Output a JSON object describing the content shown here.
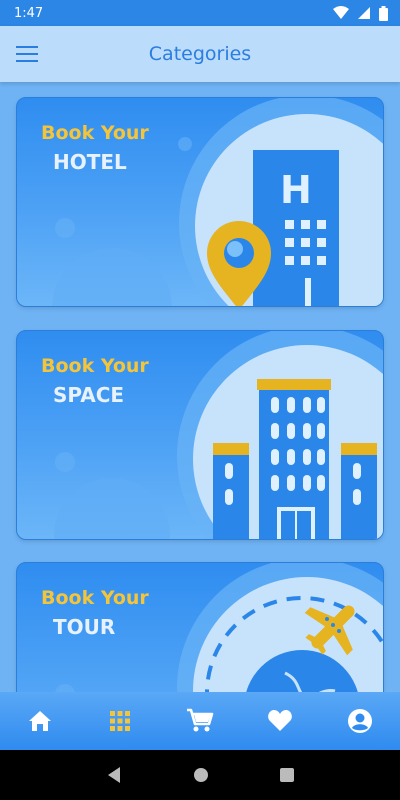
{
  "status_bar": {
    "time": "1:47"
  },
  "app_bar": {
    "title": "Categories"
  },
  "cards": [
    {
      "kicker": "Book Your",
      "title": "HOTEL"
    },
    {
      "kicker": "Book Your",
      "title": "SPACE"
    },
    {
      "kicker": "Book Your",
      "title": "TOUR"
    }
  ],
  "bottom_nav": [
    "home-icon",
    "grid-icon",
    "cart-icon",
    "heart-icon",
    "account-icon"
  ],
  "colors": {
    "accent": "#2a7de1",
    "highlight": "#f4c43a",
    "active_nav": "#f4c43a"
  }
}
